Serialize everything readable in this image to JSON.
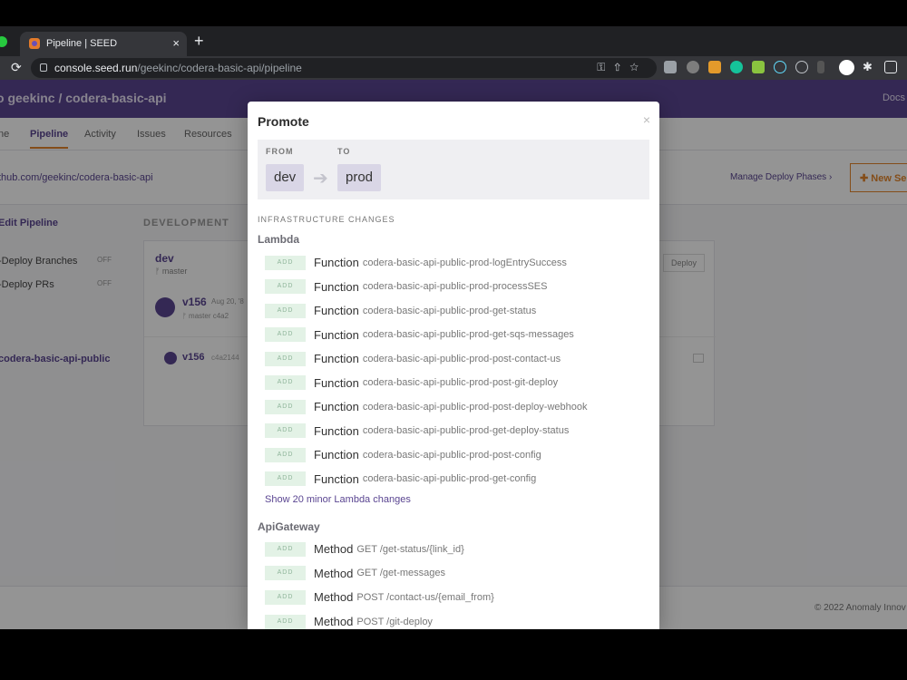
{
  "browser": {
    "tab_title": "Pipeline | SEED",
    "tab_close": "×",
    "new_tab": "+",
    "url_host": "console.seed.run",
    "url_path": "/geekinc/codera-basic-api/pipeline"
  },
  "page": {
    "breadcrumb": "o  geekinc  /  codera-basic-api",
    "docs": "Docs",
    "nav": [
      "ne",
      "Pipeline",
      "Activity",
      "Issues",
      "Resources"
    ],
    "repo_link": "thub.com/geekinc/codera-basic-api",
    "manage_phases": "Manage Deploy Phases ›",
    "new_service": "New Se",
    "side_edit": "Edit Pipeline",
    "side_branches": "-Deploy Branches",
    "side_branches_state": "OFF",
    "side_prs": "-Deploy PRs",
    "side_prs_state": "OFF",
    "side_service": "codera-basic-api-public",
    "stage_heading": "DEVELOPMENT",
    "stage_name": "dev",
    "stage_branch": "master",
    "build_version": "v156",
    "build_date": "Aug 20, '8",
    "build_branch": "master",
    "build_commit": "c4a2",
    "service_version": "v156",
    "service_commit": "c4a2144",
    "deploy_btn": "Deploy",
    "footer": "© 2022 Anomaly Innov"
  },
  "modal": {
    "title": "Promote",
    "close": "×",
    "from_label": "FROM",
    "to_label": "TO",
    "from_stage": "dev",
    "to_stage": "prod",
    "arrow": "➔",
    "section_title": "INFRASTRUCTURE CHANGES",
    "lambda_group": "Lambda",
    "lambda_changes": [
      {
        "badge": "ADD",
        "type": "Function",
        "name": "codera-basic-api-public-prod-logEntrySuccess"
      },
      {
        "badge": "ADD",
        "type": "Function",
        "name": "codera-basic-api-public-prod-processSES"
      },
      {
        "badge": "ADD",
        "type": "Function",
        "name": "codera-basic-api-public-prod-get-status"
      },
      {
        "badge": "ADD",
        "type": "Function",
        "name": "codera-basic-api-public-prod-get-sqs-messages"
      },
      {
        "badge": "ADD",
        "type": "Function",
        "name": "codera-basic-api-public-prod-post-contact-us"
      },
      {
        "badge": "ADD",
        "type": "Function",
        "name": "codera-basic-api-public-prod-post-git-deploy"
      },
      {
        "badge": "ADD",
        "type": "Function",
        "name": "codera-basic-api-public-prod-post-deploy-webhook"
      },
      {
        "badge": "ADD",
        "type": "Function",
        "name": "codera-basic-api-public-prod-get-deploy-status"
      },
      {
        "badge": "ADD",
        "type": "Function",
        "name": "codera-basic-api-public-prod-post-config"
      },
      {
        "badge": "ADD",
        "type": "Function",
        "name": "codera-basic-api-public-prod-get-config"
      }
    ],
    "show_more": "Show 20 minor Lambda changes",
    "apigw_group": "ApiGateway",
    "apigw_changes": [
      {
        "badge": "ADD",
        "type": "Method",
        "name": "GET /get-status/{link_id}"
      },
      {
        "badge": "ADD",
        "type": "Method",
        "name": "GET /get-messages"
      },
      {
        "badge": "ADD",
        "type": "Method",
        "name": "POST /contact-us/{email_from}"
      },
      {
        "badge": "ADD",
        "type": "Method",
        "name": "POST /git-deploy"
      }
    ]
  },
  "colors": {
    "brand": "#5a4591",
    "accent": "#e4862b",
    "add_badge_bg": "#e3f2e6",
    "add_badge_text": "#8fb59a"
  }
}
